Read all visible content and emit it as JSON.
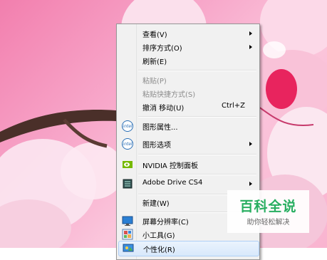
{
  "wallpaper": {
    "theme_colors": [
      "#f27fae",
      "#fbc6dc",
      "#fde7f1",
      "#5a3b33"
    ]
  },
  "context_menu": {
    "items": [
      {
        "label": "查看(V)",
        "has_submenu": true,
        "disabled": false
      },
      {
        "label": "排序方式(O)",
        "has_submenu": true,
        "disabled": false
      },
      {
        "label": "刷新(E)",
        "has_submenu": false,
        "disabled": false
      },
      {
        "label": "粘贴(P)",
        "has_submenu": false,
        "disabled": true
      },
      {
        "label": "粘贴快捷方式(S)",
        "has_submenu": false,
        "disabled": true
      },
      {
        "label": "撤消 移动(U)",
        "shortcut": "Ctrl+Z",
        "has_submenu": false,
        "disabled": false
      },
      {
        "label": "图形属性...",
        "icon": "intel-icon",
        "has_submenu": false,
        "disabled": false
      },
      {
        "label": "图形选项",
        "icon": "intel-icon",
        "has_submenu": true,
        "disabled": false
      },
      {
        "label": "NVIDIA 控制面板",
        "icon": "nvidia-icon",
        "has_submenu": false,
        "disabled": false
      },
      {
        "label": "Adobe Drive CS4",
        "icon": "adobe-drive-icon",
        "has_submenu": true,
        "disabled": false
      },
      {
        "label": "新建(W)",
        "has_submenu": true,
        "disabled": false
      },
      {
        "label": "屏幕分辨率(C)",
        "icon": "screen-resolution-icon",
        "has_submenu": false,
        "disabled": false
      },
      {
        "label": "小工具(G)",
        "icon": "gadgets-icon",
        "has_submenu": false,
        "disabled": false
      },
      {
        "label": "个性化(R)",
        "icon": "personalize-icon",
        "has_submenu": false,
        "disabled": false,
        "highlighted": true
      }
    ]
  },
  "watermark": {
    "title": "百科全说",
    "subtitle": "助你轻松解决",
    "color": "#27ae60"
  }
}
